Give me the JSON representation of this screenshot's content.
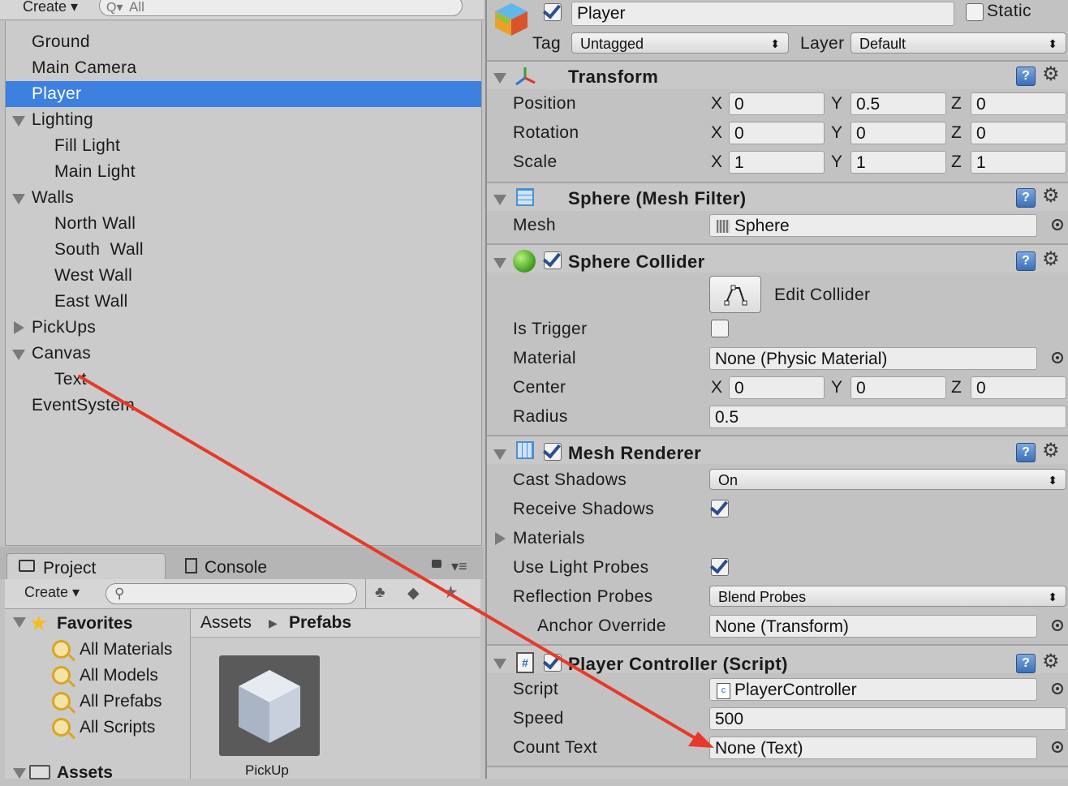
{
  "hierarchy": {
    "toolbar": {
      "create_label": "Create",
      "search_placeholder": "All"
    },
    "items": [
      {
        "label": "Ground"
      },
      {
        "label": "Main Camera"
      },
      {
        "label": "Player"
      },
      {
        "label": "Lighting"
      },
      {
        "label": "Fill Light"
      },
      {
        "label": "Main Light"
      },
      {
        "label": "Walls"
      },
      {
        "label": "North Wall"
      },
      {
        "label": "South  Wall"
      },
      {
        "label": "West Wall"
      },
      {
        "label": "East Wall"
      },
      {
        "label": "PickUps"
      },
      {
        "label": "Canvas"
      },
      {
        "label": "Text"
      },
      {
        "label": "EventSystem"
      }
    ],
    "selected": "Player"
  },
  "project": {
    "tabs": [
      {
        "label": "Project"
      },
      {
        "label": "Console"
      }
    ],
    "toolbar": {
      "create_label": "Create"
    },
    "favorites": {
      "label": "Favorites",
      "items": [
        {
          "label": "All Materials"
        },
        {
          "label": "All Models"
        },
        {
          "label": "All Prefabs"
        },
        {
          "label": "All Scripts"
        }
      ]
    },
    "assets_label": "Assets",
    "breadcrumb": {
      "root": "Assets",
      "current": "Prefabs"
    },
    "asset_items": [
      {
        "label": "PickUp"
      }
    ]
  },
  "inspector": {
    "object": {
      "name": "Player",
      "static_label": "Static",
      "tag_label": "Tag",
      "tag_value": "Untagged",
      "layer_label": "Layer",
      "layer_value": "Default",
      "active": true,
      "static": false
    },
    "transform": {
      "title": "Transform",
      "rows": [
        {
          "label": "Position",
          "x": "0",
          "y": "0.5",
          "z": "0"
        },
        {
          "label": "Rotation",
          "x": "0",
          "y": "0",
          "z": "0"
        },
        {
          "label": "Scale",
          "x": "1",
          "y": "1",
          "z": "1"
        }
      ],
      "axis": {
        "x": "X",
        "y": "Y",
        "z": "Z"
      }
    },
    "mesh_filter": {
      "title": "Sphere (Mesh Filter)",
      "mesh_label": "Mesh",
      "mesh_value": "Sphere"
    },
    "sphere_collider": {
      "title": "Sphere Collider",
      "edit_label": "Edit Collider",
      "is_trigger_label": "Is Trigger",
      "is_trigger": false,
      "material_label": "Material",
      "material_value": "None (Physic Material)",
      "center_label": "Center",
      "center": {
        "x": "0",
        "y": "0",
        "z": "0"
      },
      "radius_label": "Radius",
      "radius_value": "0.5"
    },
    "mesh_renderer": {
      "title": "Mesh Renderer",
      "cast_shadows_label": "Cast Shadows",
      "cast_shadows_value": "On",
      "receive_shadows_label": "Receive Shadows",
      "receive_shadows": true,
      "materials_label": "Materials",
      "use_light_probes_label": "Use Light Probes",
      "use_light_probes": true,
      "reflection_probes_label": "Reflection Probes",
      "reflection_probes_value": "Blend Probes",
      "anchor_override_label": "Anchor Override",
      "anchor_override_value": "None (Transform)"
    },
    "player_controller": {
      "title": "Player Controller (Script)",
      "script_label": "Script",
      "script_value": "PlayerController",
      "speed_label": "Speed",
      "speed_value": "500",
      "count_text_label": "Count Text",
      "count_text_value": "None (Text)"
    }
  },
  "colors": {
    "selection": "#3d80df",
    "annotation_arrow": "#e8382a"
  }
}
